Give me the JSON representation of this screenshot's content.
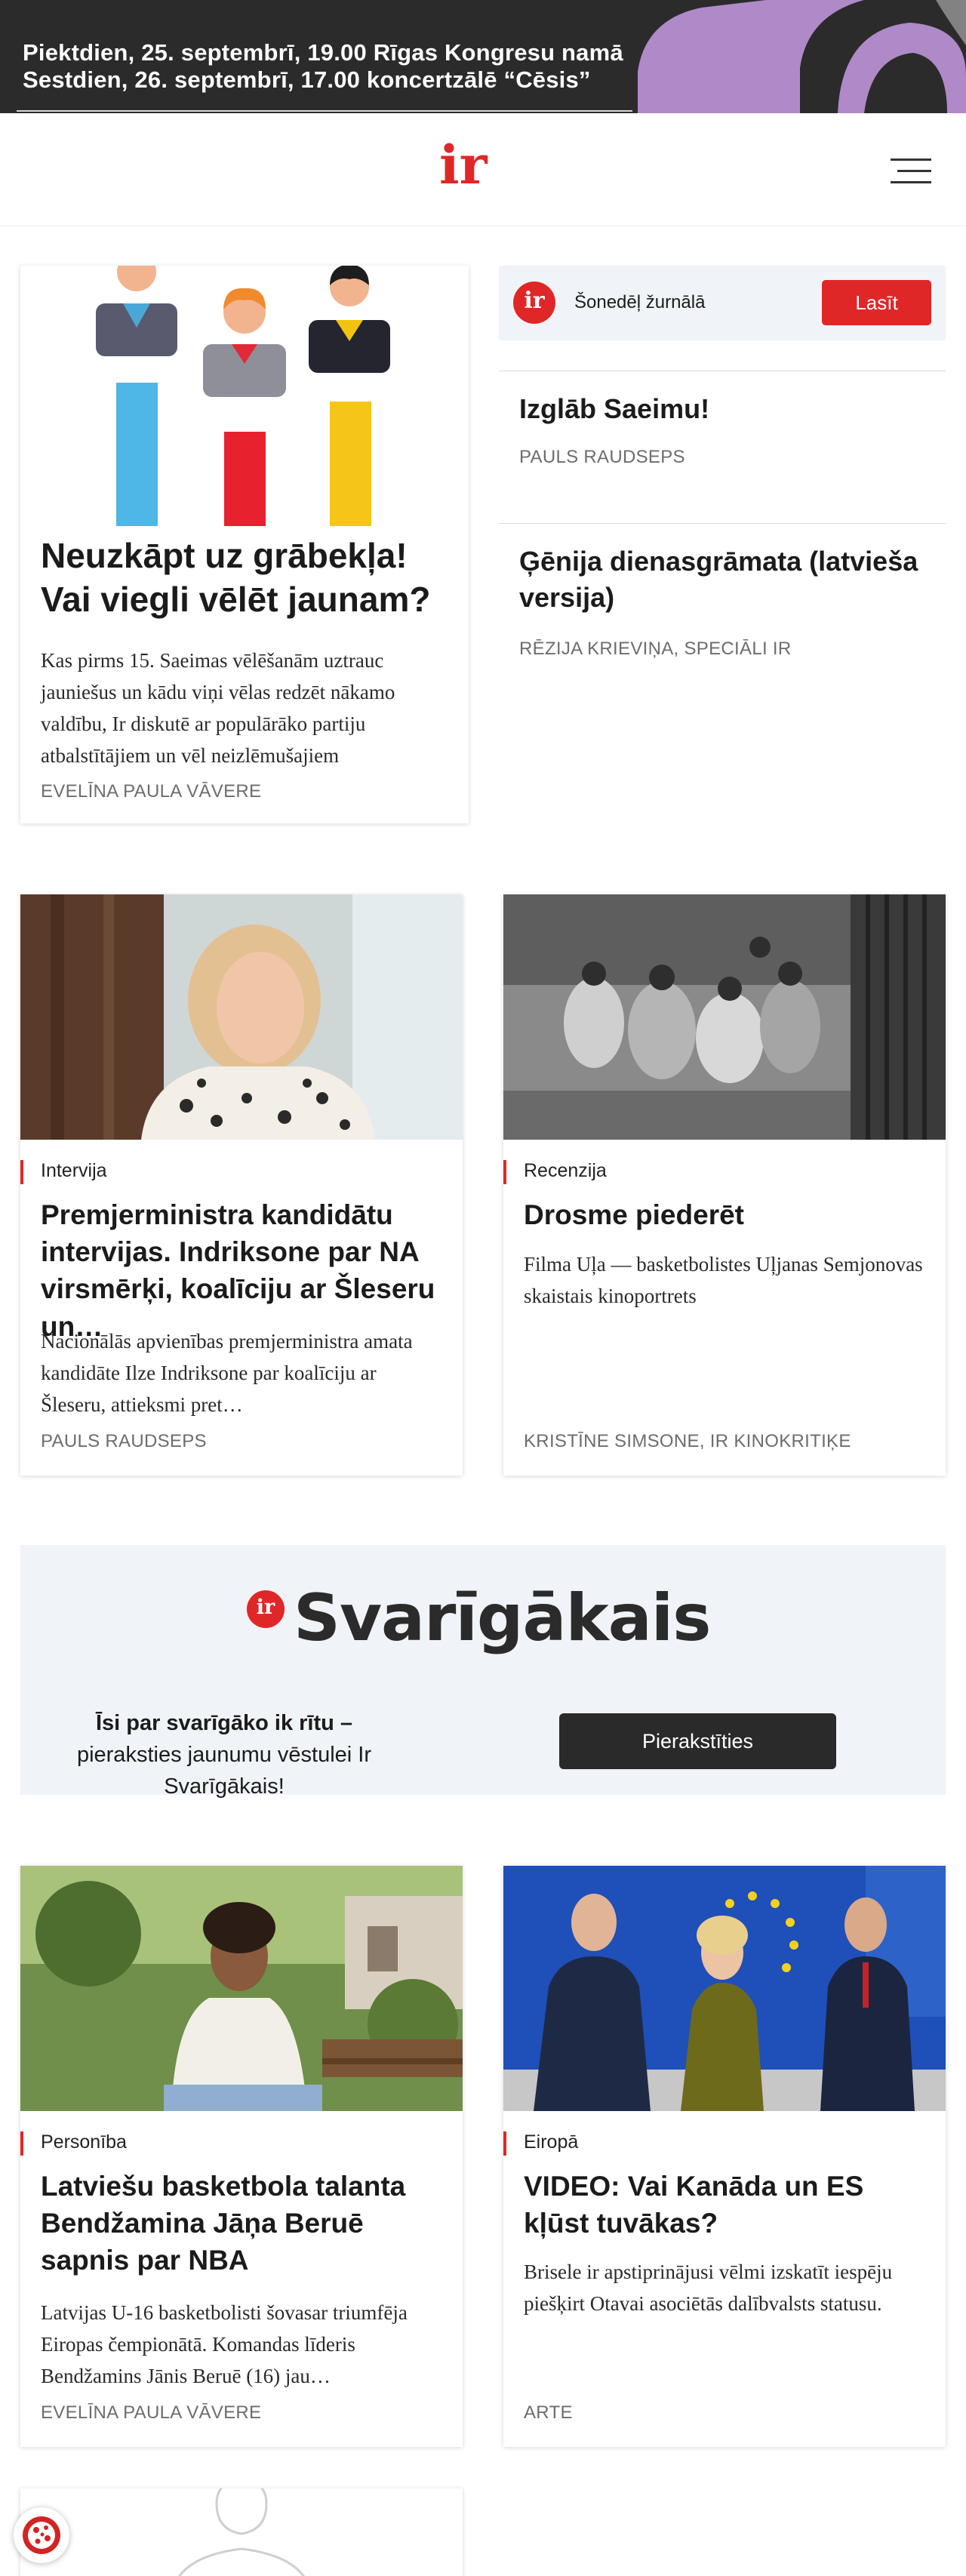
{
  "banner": {
    "line1": "Piektdien, 25. septembrī, 19.00 Rīgas Kongresu namā",
    "line2": "Sestdien, 26. septembrī, 17.00 koncertzālē “Cēsis”"
  },
  "header": {
    "logo": "ir",
    "menu_icon": "hamburger-menu-icon"
  },
  "featured": {
    "title": "Neuzkāpt uz grābekļa! Vai viegli vēlēt jaunam?",
    "lede": "Kas pirms 15. Saeimas vēlēšanām uztrauc jauniešus un kādu viņi vēlas redzēt nākamo valdību, Ir diskutē ar populārāko partiju atbalstītājiem un vēl neizlēmušajiem",
    "author": "Evelīna Paula Vāvere"
  },
  "sidebar": {
    "weekly_label": "Šonedēļ žurnālā",
    "weekly_button": "Lasīt",
    "weekly_logo": "ir",
    "items": [
      {
        "title": "Izglāb Saeimu!",
        "author": "Pauls Raudseps"
      },
      {
        "title": "Ģēnija dienasgrāmata (latvieša versija)",
        "author": "Rēzija Krieviņa, speciāli Ir"
      }
    ]
  },
  "cards": [
    {
      "category": "Intervija",
      "title": "Premjerministra kandidātu intervijas. Indriksone par NA virsmērķi, koalīciju ar Šleseru un…",
      "lede": "Nacionālās apvienības premjerministra amata kandidāte Ilze Indriksone par koalīciju ar Šleseru, attieksmi pret…",
      "author": "Pauls Raudseps"
    },
    {
      "category": "Recenzija",
      "title": "Drosme piederēt",
      "lede": "Filma Uļa — basketbolistes Uļjanas Semjonovas skaistais kinoportrets",
      "author": "Kristīne Simsone, Ir kinokritiķe"
    },
    {
      "category": "Personība",
      "title": "Latviešu basketbola talanta Bendžamina Jāņa Beruē sapnis par NBA",
      "lede": "Latvijas U-16 basketbolisti šovasar triumfēja Eiropas čempionātā. Komandas līderis Bendžamins Jānis Beruē (16) jau…",
      "author": "Evelīna Paula Vāvere"
    },
    {
      "category": "Eiropā",
      "title": "VIDEO: Vai Kanāda un ES kļūst tuvākas?",
      "lede": "Brisele ir apstiprinājusi vēlmi izskatīt iespēju piešķirt Otavai asociētās dalībvalsts statusu.",
      "author": "Arte"
    }
  ],
  "newsletter": {
    "logo_dot": "ir",
    "brand": "Svarīgākais",
    "text_bold": "Īsi par svarīgāko ik rītu –",
    "text_rest": " pieraksties jaunumu vēstulei Ir Svarīgākais!",
    "button": "Pierakstīties"
  },
  "cookie": {
    "icon": "cookie-settings-icon"
  },
  "colors": {
    "brand_red": "#e02727",
    "dark": "#2a2a2a",
    "panel": "#f0f3f7"
  }
}
